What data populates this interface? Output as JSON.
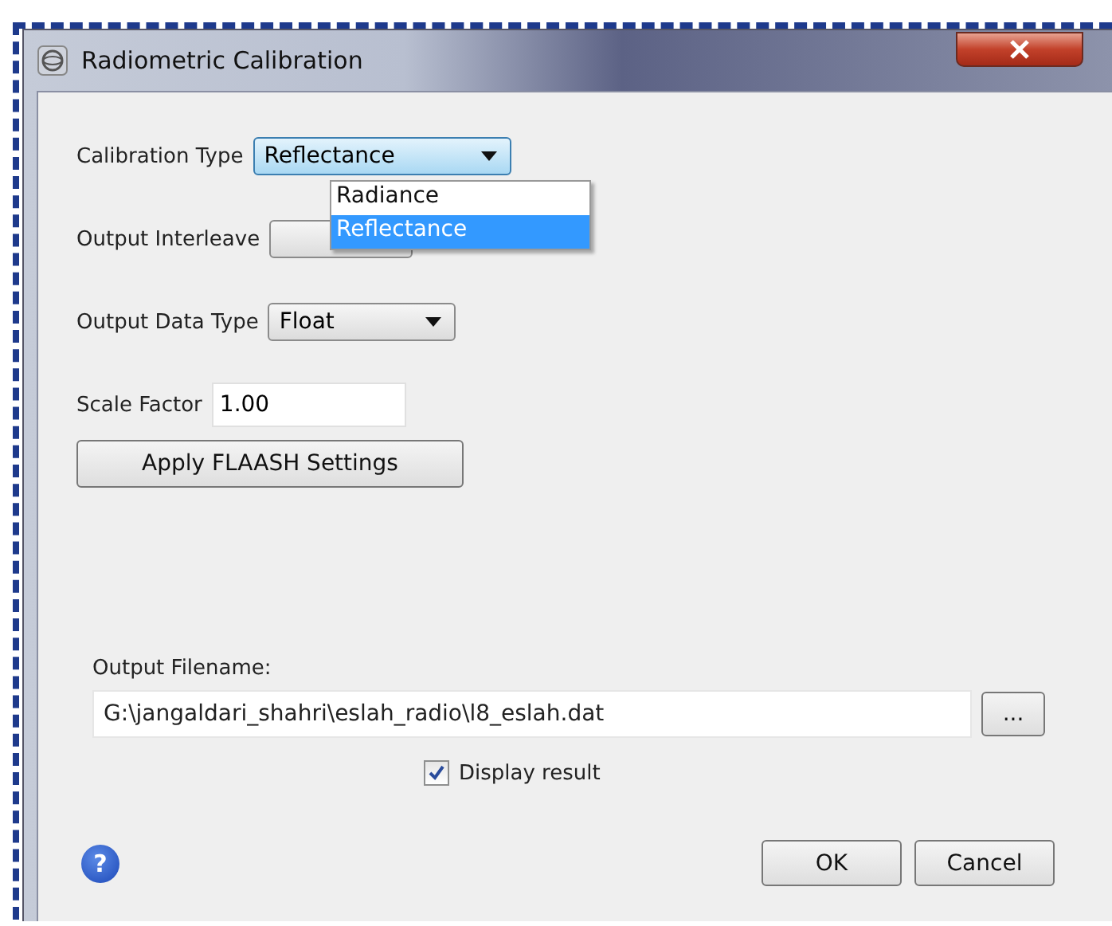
{
  "window": {
    "title": "Radiometric Calibration"
  },
  "fields": [
    {
      "kind": "dropdown",
      "label": "Calibration Type",
      "value": "Reflectance",
      "focused": true
    },
    {
      "kind": "dropdown",
      "label": "Output Interleave"
    },
    {
      "kind": "dropdown",
      "label": "Output Data Type",
      "value": "Float",
      "focused": false
    },
    {
      "kind": "text",
      "label": "Scale Factor",
      "value": "1.00"
    }
  ],
  "dropdown_menu": {
    "items": [
      {
        "label": "Radiance",
        "selected": false
      },
      {
        "label": "Reflectance",
        "selected": true
      }
    ]
  },
  "apply_button": "Apply FLAASH Settings",
  "output": {
    "label": "Output Filename:",
    "value": "G:\\jangaldari_shahri\\eslah_radio\\l8_eslah.dat",
    "browse": "..."
  },
  "display_result": {
    "label": "Display result",
    "checked": true
  },
  "help": "?",
  "buttons": [
    "OK",
    "Cancel"
  ]
}
